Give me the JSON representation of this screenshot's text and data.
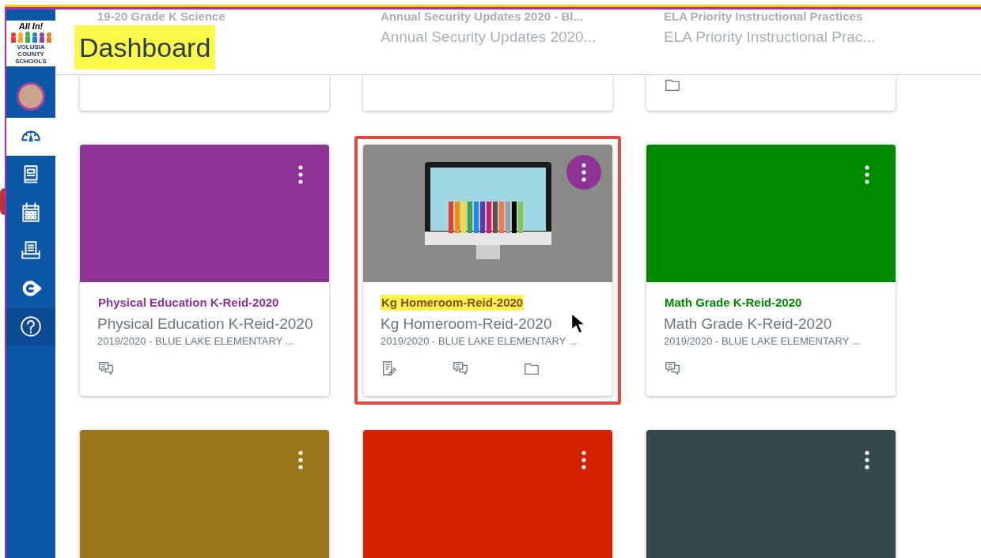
{
  "logo": {
    "title": "All In!",
    "subtitle": "VOLUSIA COUNTY SCHOOLS"
  },
  "nav": [
    {
      "kind": "dashboard",
      "selected": true
    },
    {
      "kind": "courses",
      "selected": false
    },
    {
      "kind": "calendar",
      "selected": false
    },
    {
      "kind": "inbox",
      "selected": false
    },
    {
      "kind": "logout",
      "selected": false
    },
    {
      "kind": "help",
      "selected": false
    }
  ],
  "header": {
    "title": "Dashboard"
  },
  "cards": [
    {
      "kind": "partial",
      "title": "19-20 Grade K Science",
      "highlighted": false
    },
    {
      "kind": "partial",
      "title": "Annual Security Updates 2020 - Bl...",
      "subtitle": "Annual Security Updates 2020...",
      "highlighted": false
    },
    {
      "kind": "partial",
      "title": "ELA Priority Instructional Practices",
      "subtitle": "ELA Priority Instructional Prac...",
      "icons": [
        {
          "kind": "files"
        }
      ],
      "highlighted": false
    },
    {
      "title": "Physical Education K-Reid-2020",
      "subtitle": "Physical Education K-Reid-2020",
      "term": "2019/2020 - BLUE LAKE ELEMENTARY ...",
      "color": "#8d3396",
      "kind": "color",
      "icons": [
        {
          "kind": "discussions"
        }
      ],
      "highlighted": false
    },
    {
      "title": "Kg Homeroom-Reid-2020",
      "subtitle": "Kg Homeroom-Reid-2020",
      "term": "2019/2020 - BLUE LAKE ELEMENTARY ...",
      "color": "#8d3396",
      "kind": "image",
      "icons": [
        {
          "kind": "assignments"
        },
        {
          "kind": "discussions"
        },
        {
          "kind": "files"
        }
      ],
      "highlighted": true
    },
    {
      "title": "Math Grade K-Reid-2020",
      "subtitle": "Math Grade K-Reid-2020",
      "term": "2019/2020 - BLUE LAKE ELEMENTARY ...",
      "color": "#008a00",
      "kind": "color",
      "icons": [
        {
          "kind": "discussions"
        }
      ],
      "highlighted": false
    },
    {
      "color": "#9b7519",
      "kind": "color",
      "highlighted": false
    },
    {
      "color": "#d41f00",
      "kind": "color",
      "highlighted": false
    },
    {
      "color": "#34494b",
      "kind": "color",
      "highlighted": false
    }
  ]
}
